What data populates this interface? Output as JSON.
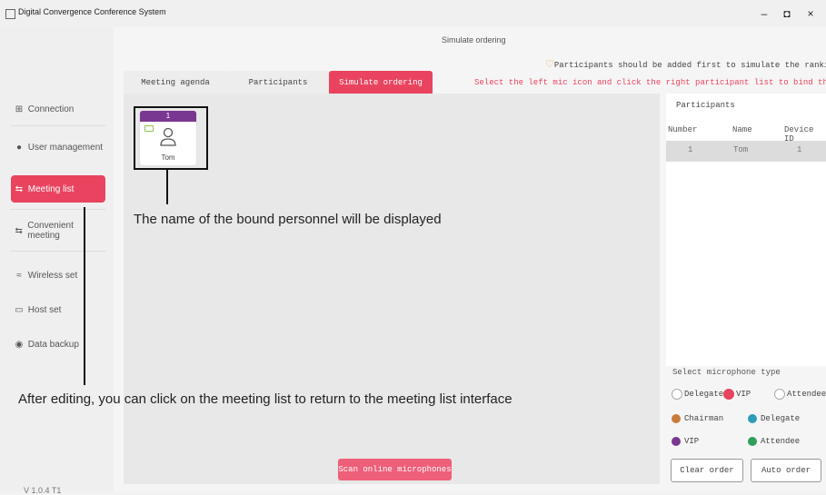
{
  "window": {
    "title": "Digital Convergence Conference System",
    "minimize": "–",
    "maximize": "◘",
    "close": "×"
  },
  "sidebar": {
    "items": [
      {
        "label": "Connection",
        "icon": "network-icon"
      },
      {
        "label": "User management",
        "icon": "user-icon"
      },
      {
        "label": "Meeting list",
        "icon": "sync-icon"
      },
      {
        "label": "Convenient meeting",
        "icon": "sync-icon"
      },
      {
        "label": "Wireless set",
        "icon": "wifi-icon"
      },
      {
        "label": "Host set",
        "icon": "host-icon"
      },
      {
        "label": "Data backup",
        "icon": "backup-icon"
      }
    ],
    "active_index": 2,
    "version": "V 1.0.4 T1"
  },
  "main": {
    "heading": "Simulate ordering",
    "tabs": [
      "Meeting agenda",
      "Participants",
      "Simulate ordering"
    ],
    "active_tab": 2,
    "hint_ranking": "Participants should be added first to simulate the ranking",
    "hint_bind": "Select the left mic icon and click the right participant list to bind the mic",
    "mic_card": {
      "number": "1",
      "name": "Tom"
    },
    "scan_button": "Scan online microphones"
  },
  "annotations": {
    "bound_name": "The name of the bound personnel will be displayed",
    "return_hint": "After editing, you can click on the meeting list to return to the meeting list interface"
  },
  "participants_panel": {
    "title": "Participants",
    "columns": [
      "Number",
      "Name",
      "Device ID"
    ],
    "rows": [
      {
        "number": "1",
        "name": "Tom",
        "device_id": "1"
      }
    ]
  },
  "mic_type": {
    "label": "Select microphone type",
    "options": [
      "Delegate",
      "VIP",
      "Attendee"
    ],
    "selected": "VIP"
  },
  "legend": [
    {
      "label": "Chairman",
      "color": "#c97a3a"
    },
    {
      "label": "Delegate",
      "color": "#2e9cb8"
    },
    {
      "label": "VIP",
      "color": "#7a3792"
    },
    {
      "label": "Attendee",
      "color": "#2f9e5b"
    }
  ],
  "buttons": {
    "clear_order": "Clear order",
    "auto_order": "Auto order"
  },
  "colors": {
    "accent": "#e9435f",
    "mic_header": "#7a3792"
  }
}
